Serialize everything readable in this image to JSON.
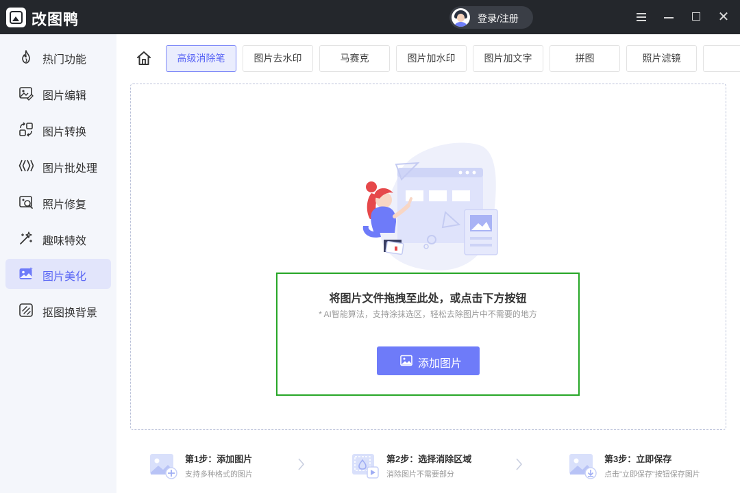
{
  "app": {
    "title": "改图鸭",
    "login_label": "登录/注册",
    "accent_color": "#6e7bf9",
    "highlight_color": "#26a626"
  },
  "window_controls": [
    {
      "name": "menu-icon"
    },
    {
      "name": "minimize-icon"
    },
    {
      "name": "maximize-icon"
    },
    {
      "name": "close-icon",
      "glyph": "✕"
    }
  ],
  "sidebar": {
    "items": [
      {
        "label": "热门功能",
        "icon": "flame-icon"
      },
      {
        "label": "图片编辑",
        "icon": "image-edit-icon"
      },
      {
        "label": "图片转换",
        "icon": "convert-icon"
      },
      {
        "label": "图片批处理",
        "icon": "batch-icon"
      },
      {
        "label": "照片修复",
        "icon": "photo-repair-icon"
      },
      {
        "label": "趣味特效",
        "icon": "magic-wand-icon"
      },
      {
        "label": "图片美化",
        "icon": "beautify-icon",
        "active": true
      },
      {
        "label": "抠图换背景",
        "icon": "cutout-icon"
      }
    ]
  },
  "tabs": {
    "home_icon": "home-icon",
    "items": [
      {
        "label": "高级消除笔",
        "active": true
      },
      {
        "label": "图片去水印"
      },
      {
        "label": "马赛克"
      },
      {
        "label": "图片加水印"
      },
      {
        "label": "图片加文字"
      },
      {
        "label": "拼图"
      },
      {
        "label": "照片滤镜"
      }
    ]
  },
  "dropzone": {
    "title": "将图片文件拖拽至此处，或点击下方按钮",
    "hint": "* AI智能算法，支持涂抹选区，轻松去除图片中不需要的地方",
    "add_button_label": "添加图片"
  },
  "steps": [
    {
      "title": "第1步：添加图片",
      "desc": "支持多种格式的图片",
      "icon": "add-image-icon"
    },
    {
      "title": "第2步：选择消除区域",
      "desc": "消除图片不需要部分",
      "icon": "select-area-icon"
    },
    {
      "title": "第3步：立即保存",
      "desc": "点击\"立即保存\"按钮保存图片",
      "icon": "save-image-icon"
    }
  ]
}
